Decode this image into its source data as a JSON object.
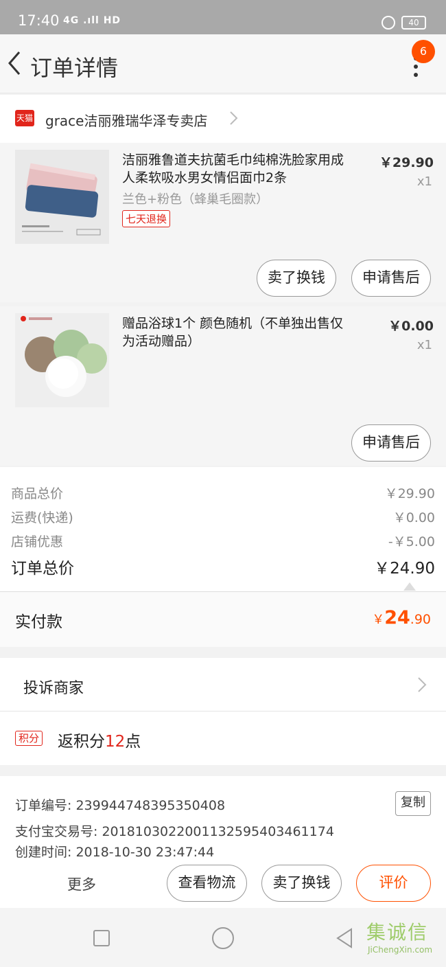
{
  "status_bar": {
    "time": "17:40",
    "network": "4G .ıll HD",
    "battery": "40"
  },
  "nav": {
    "title": "订单详情",
    "badge_count": "6"
  },
  "shop": {
    "badge": "天猫",
    "name": "grace洁丽雅瑞华泽专卖店"
  },
  "items": [
    {
      "title": "洁丽雅鲁道夫抗菌毛巾纯棉洗脸家用成人柔软吸水男女情侣面巾2条",
      "sku": "兰色+粉色（蜂巢毛圈款）",
      "tag": "七天退换",
      "price": "￥29.90",
      "qty": "x1",
      "buttons": [
        "卖了换钱",
        "申请售后"
      ]
    },
    {
      "title": "赠品浴球1个 颜色随机（不单独出售仅为活动赠品）",
      "price": "￥0.00",
      "qty": "x1",
      "buttons": [
        "申请售后"
      ]
    }
  ],
  "totals": {
    "goods_label": "商品总价",
    "goods_value": "￥29.90",
    "shipping_label": "运费(快递)",
    "shipping_value": "￥0.00",
    "discount_label": "店铺优惠",
    "discount_value": "-￥5.00",
    "order_label": "订单总价",
    "order_value": "￥24.90"
  },
  "paid": {
    "label": "实付款",
    "currency": "￥",
    "int": "24",
    "dec": ".90"
  },
  "complain": {
    "label": "投诉商家"
  },
  "points": {
    "tag": "积分",
    "prefix": "返积分",
    "num": "12",
    "suffix": "点"
  },
  "order_info": {
    "order_no": "订单编号: 2399447483953504​08",
    "alipay_no": "支付宝交易号: 2018103022001132595403461174",
    "created": "创建时间: 2018-10-30 23:47:44",
    "copy_label": "复制"
  },
  "actions": {
    "more": "更多",
    "logistics": "查看物流",
    "resell": "卖了换钱",
    "review": "评价"
  },
  "watermark": {
    "cn": "集诚信",
    "en": "JiChengXin.com"
  },
  "colors": {
    "accent": "#ff5000",
    "tmall_red": "#e1251b"
  }
}
